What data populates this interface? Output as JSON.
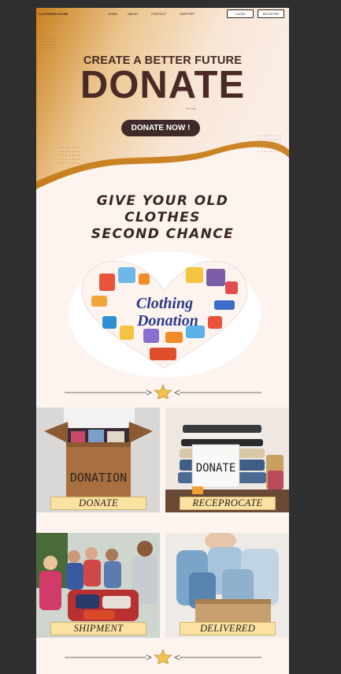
{
  "nav": {
    "brand": "CLOTHES&CAUSE",
    "links": [
      "HOME",
      "ABOUT",
      "CONTACT",
      "SUPPORT"
    ],
    "login": "LOGIN",
    "register": "REGISTER"
  },
  "hero": {
    "tagline": "CREATE A BETTER FUTURE",
    "title": "DONATE",
    "small_text": "CITYLNG",
    "cta": "DONATE NOW !"
  },
  "headline": {
    "line1": "GIVE YOUR OLD",
    "line2": "CLOTHES",
    "line3": "SECOND CHANCE"
  },
  "heart_image": {
    "line1": "Clothing",
    "line2": "Donation"
  },
  "cards": [
    {
      "caption": "DONATE",
      "box_text": "DONATION"
    },
    {
      "caption": "RECEPROCATE",
      "sign_text": "DONATE"
    },
    {
      "caption": "SHIPMENT"
    },
    {
      "caption": "DELIVERED"
    }
  ],
  "colors": {
    "background": "#2f2f2f",
    "page": "#fdf3ef",
    "hero_gold": "#d08a2a",
    "text_dark": "#4a2a25",
    "caption_bg": "#fbe2a2",
    "star": "#f2c14e"
  }
}
